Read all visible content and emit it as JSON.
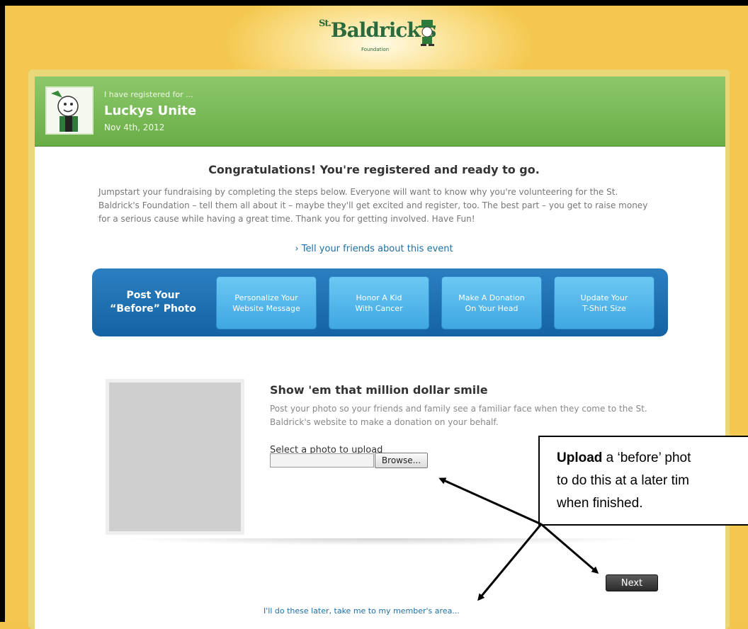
{
  "logo": {
    "text": "Baldrick's",
    "prefix": "St.",
    "sub": "Foundation"
  },
  "header": {
    "registered_for": "I have registered for ...",
    "event_name": "Luckys Unite",
    "event_date": "Nov 4th, 2012"
  },
  "main": {
    "title": "Congratulations! You're registered and ready to go.",
    "intro": "Jumpstart your fundraising by completing the steps below. Everyone will want to know why you're volunteering for the St. Baldrick's Foundation – tell them all about it – maybe they'll get excited and register, too. The best part – you get to raise money for a serious cause while having a great time. Thank you for getting involved. Have Fun!",
    "tell_link": "› Tell your friends about this event"
  },
  "steps": {
    "current": {
      "line1": "Post Your",
      "line2": "“Before” Photo"
    },
    "items": [
      {
        "line1": "Personalize Your",
        "line2": "Website Message"
      },
      {
        "line1": "Honor A Kid",
        "line2": "With Cancer"
      },
      {
        "line1": "Make A Donation",
        "line2": "On Your Head"
      },
      {
        "line1": "Update Your",
        "line2": "T-Shirt Size"
      }
    ]
  },
  "upload": {
    "title": "Show 'em that million dollar smile",
    "text": "Post your photo so your friends and family see a familiar face when they come to the St. Baldrick's website to make a donation on your behalf.",
    "select_label": "Select a photo to upload",
    "browse_label": "Browse..."
  },
  "actions": {
    "next_label": "Next",
    "later_link": "I'll do these later, take me to my member's area..."
  },
  "callout": {
    "bold": "Upload",
    "line1_rest": " a ‘before’ phot",
    "line2": "to do this at a later tim",
    "line3": "when finished."
  },
  "colors": {
    "header_green": "#74b452",
    "steps_blue": "#1a6cad",
    "link_blue": "#1d6fa5",
    "page_gold": "#f2c64c"
  }
}
